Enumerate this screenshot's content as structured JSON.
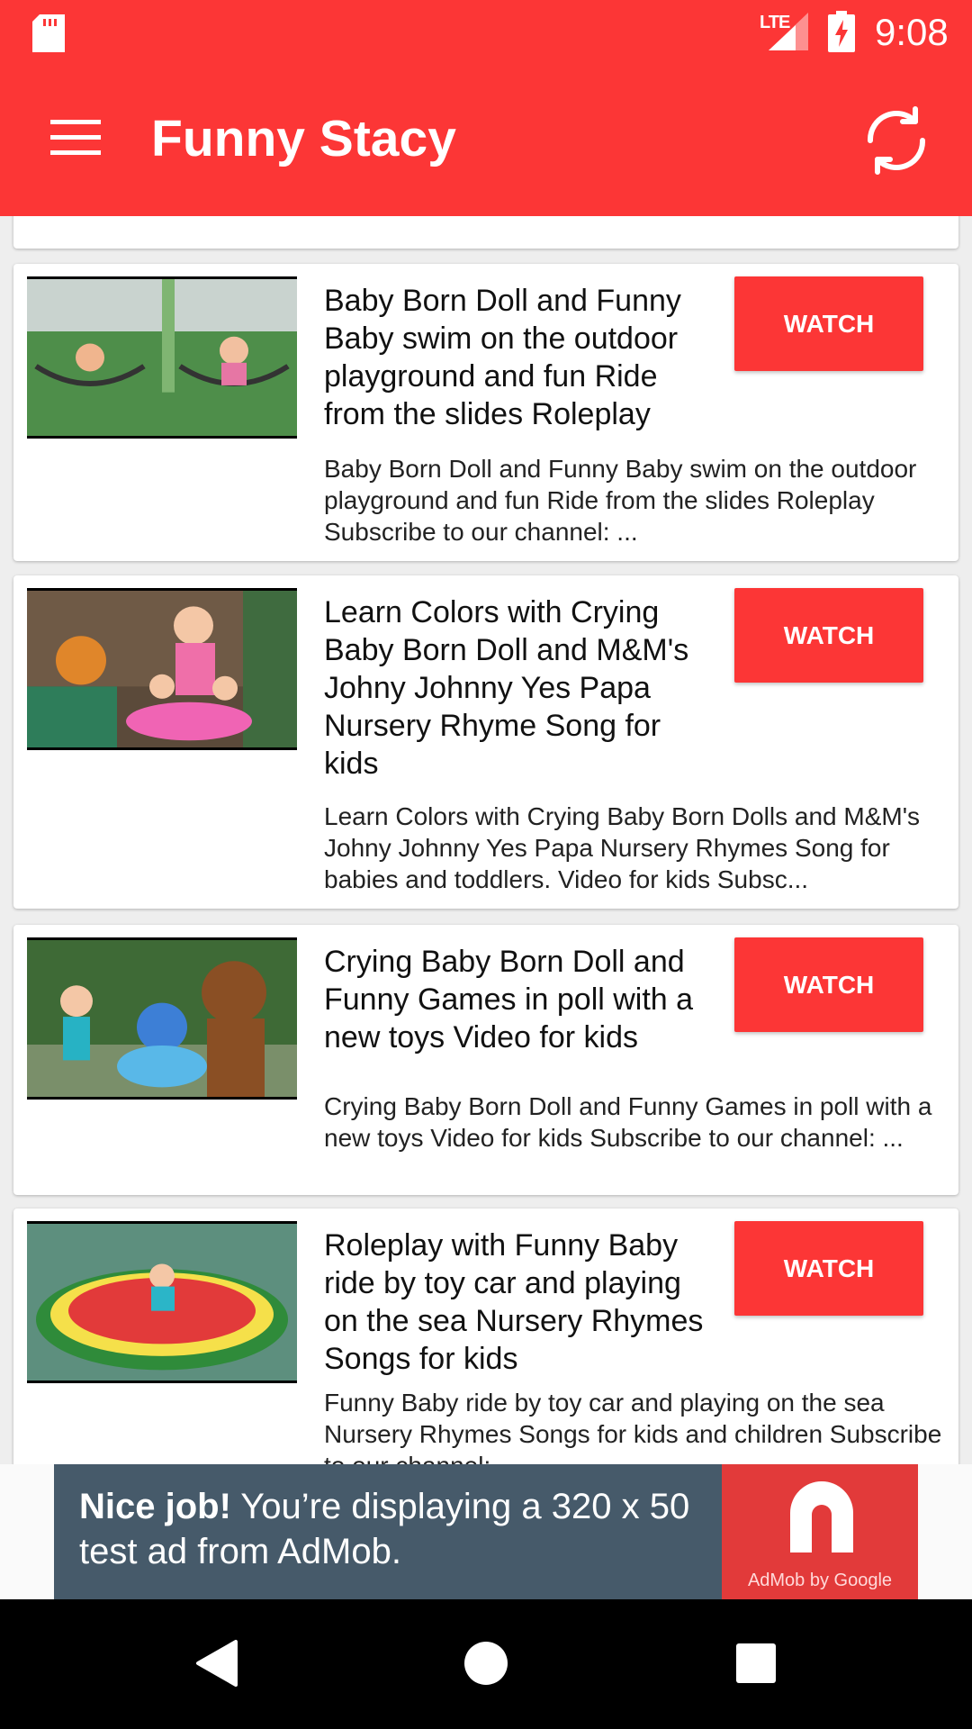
{
  "status_bar": {
    "network": "LTE",
    "time": "9:08",
    "icons": [
      "sd-card-icon",
      "signal-icon",
      "battery-charging-icon"
    ]
  },
  "app_bar": {
    "title": "Funny Stacy",
    "menu_icon": "hamburger-menu-icon",
    "refresh_icon": "refresh-icon"
  },
  "colors": {
    "accent": "#fc3636",
    "ad_background": "#465a6a",
    "ad_brand": "#e23a3a"
  },
  "videos": [
    {
      "title": "Baby Born Doll and Funny Baby swim on the outdoor playground and fun Ride from the slides Roleplay",
      "description": "Baby Born Doll and Funny Baby swim on the outdoor playground and fun Ride from the slides Roleplay Subscribe to our channel: ...",
      "button": "WATCH"
    },
    {
      "title": "Learn Colors with Crying Baby Born Doll and M&M's Johny Johnny Yes Papa Nursery Rhyme Song for kids",
      "description": "Learn Colors with Crying Baby Born Dolls and M&M's Johny Johnny Yes Papa Nursery Rhymes Song for babies and toddlers. Video for kids Subsc...",
      "button": "WATCH"
    },
    {
      "title": "Crying Baby Born Doll and Funny Games in poll with a new toys Video for kids",
      "description": "Crying Baby Born Doll and Funny Games in poll with a new toys Video for kids Subscribe to our channel: ...",
      "button": "WATCH"
    },
    {
      "title": "Roleplay with Funny Baby ride by toy car and playing on the sea Nursery Rhymes Songs for kids",
      "description": "Funny Baby ride by toy car and playing on the sea Nursery Rhymes Songs for kids and children Subscribe to our channel: ...",
      "button": "WATCH"
    }
  ],
  "ad": {
    "headline": "Nice job!",
    "body": " You’re displaying a 320 x 50 test ad from AdMob.",
    "brand": "AdMob by Google"
  },
  "nav_bar": {
    "icons": [
      "back-icon",
      "home-icon",
      "recents-icon"
    ]
  }
}
